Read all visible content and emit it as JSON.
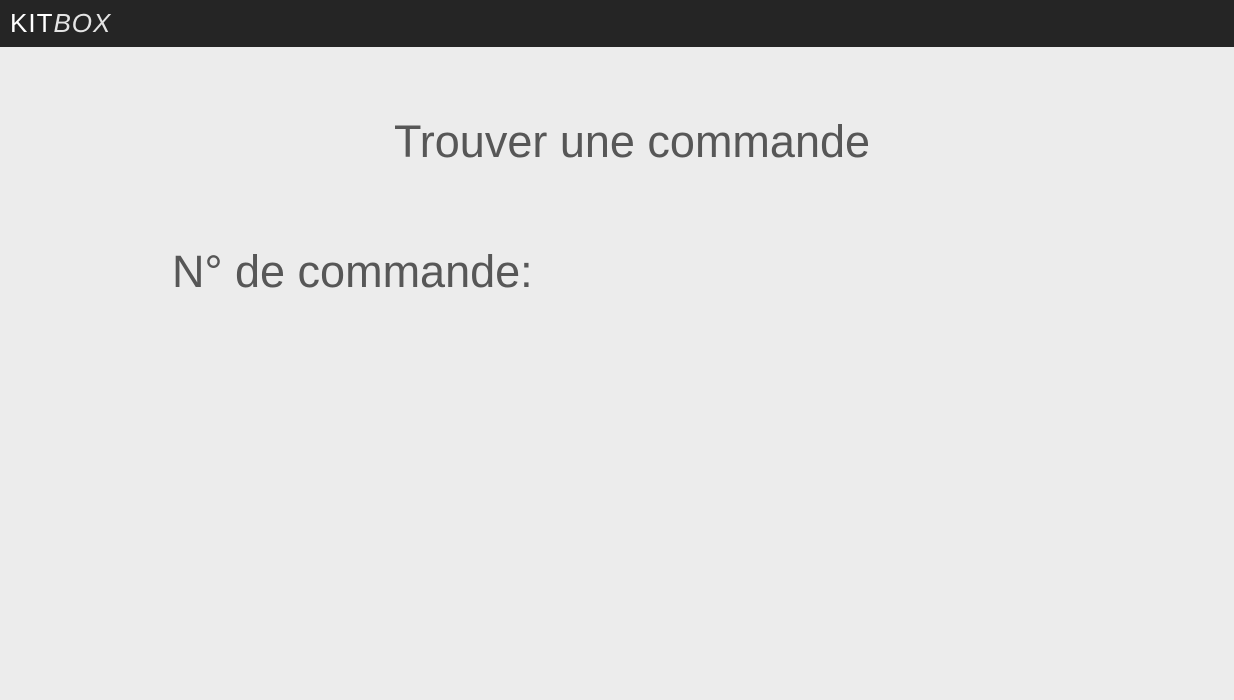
{
  "header": {
    "logo_primary": "KIT",
    "logo_secondary": "BOX"
  },
  "main": {
    "title": "Trouver une commande",
    "order_number_label": "N° de commande:"
  },
  "colors": {
    "header_background": "#252525",
    "page_background": "#ececec",
    "text": "#575757"
  }
}
